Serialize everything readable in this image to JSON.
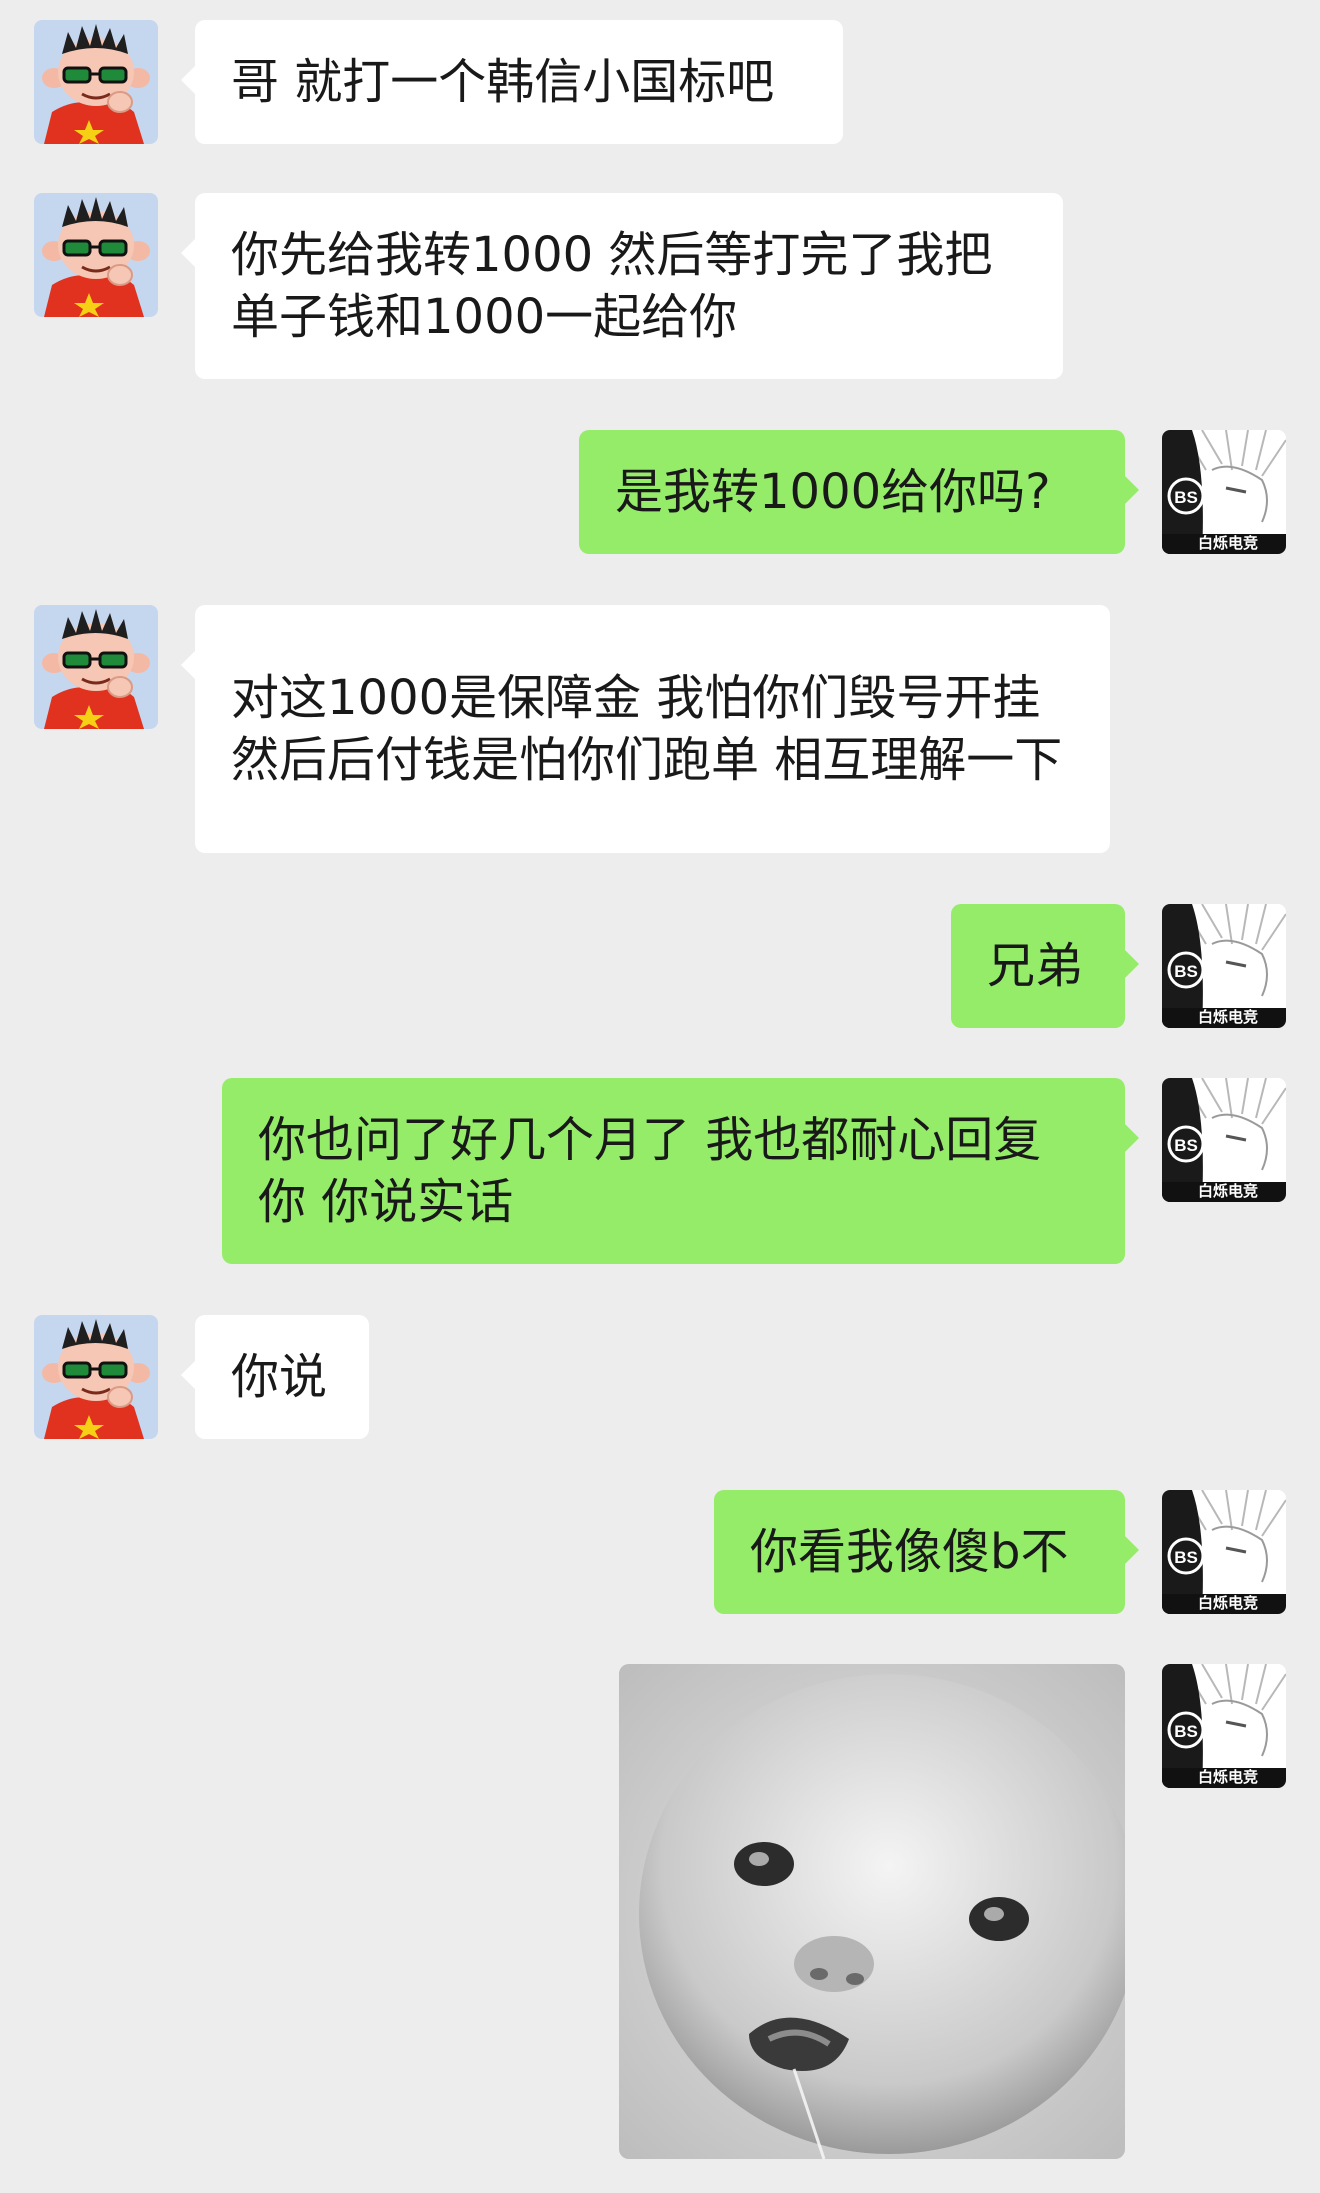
{
  "chat": {
    "messages": [
      {
        "side": "in",
        "text": "哥 就打一个韩信小国标吧"
      },
      {
        "side": "in",
        "text": "你先给我转1000 然后等打完了我把单子钱和1000一起给你"
      },
      {
        "side": "out",
        "text": "是我转1000给你吗?"
      },
      {
        "side": "in",
        "text": "对这1000是保障金 我怕你们毁号开挂 然后后付钱是怕你们跑单 相互理解一下"
      },
      {
        "side": "out",
        "text": "兄弟"
      },
      {
        "side": "out",
        "text": "你也问了好几个月了 我也都耐心回复你 你说实话"
      },
      {
        "side": "in",
        "text": "你说"
      },
      {
        "side": "out",
        "text": "你看我像傻b不"
      },
      {
        "side": "out",
        "type": "sticker",
        "sticker": "baby-face-meme"
      }
    ]
  },
  "avatars": {
    "contact": {
      "icon": "cartoon-boy-sunglasses-avatar"
    },
    "self": {
      "icon": "anime-boy-bs-logo-avatar",
      "caption": "白烁电竞",
      "badge": "BS"
    }
  },
  "colors": {
    "background": "#ededed",
    "incoming_bubble": "#ffffff",
    "outgoing_bubble": "#95ec69",
    "text": "#191919"
  }
}
